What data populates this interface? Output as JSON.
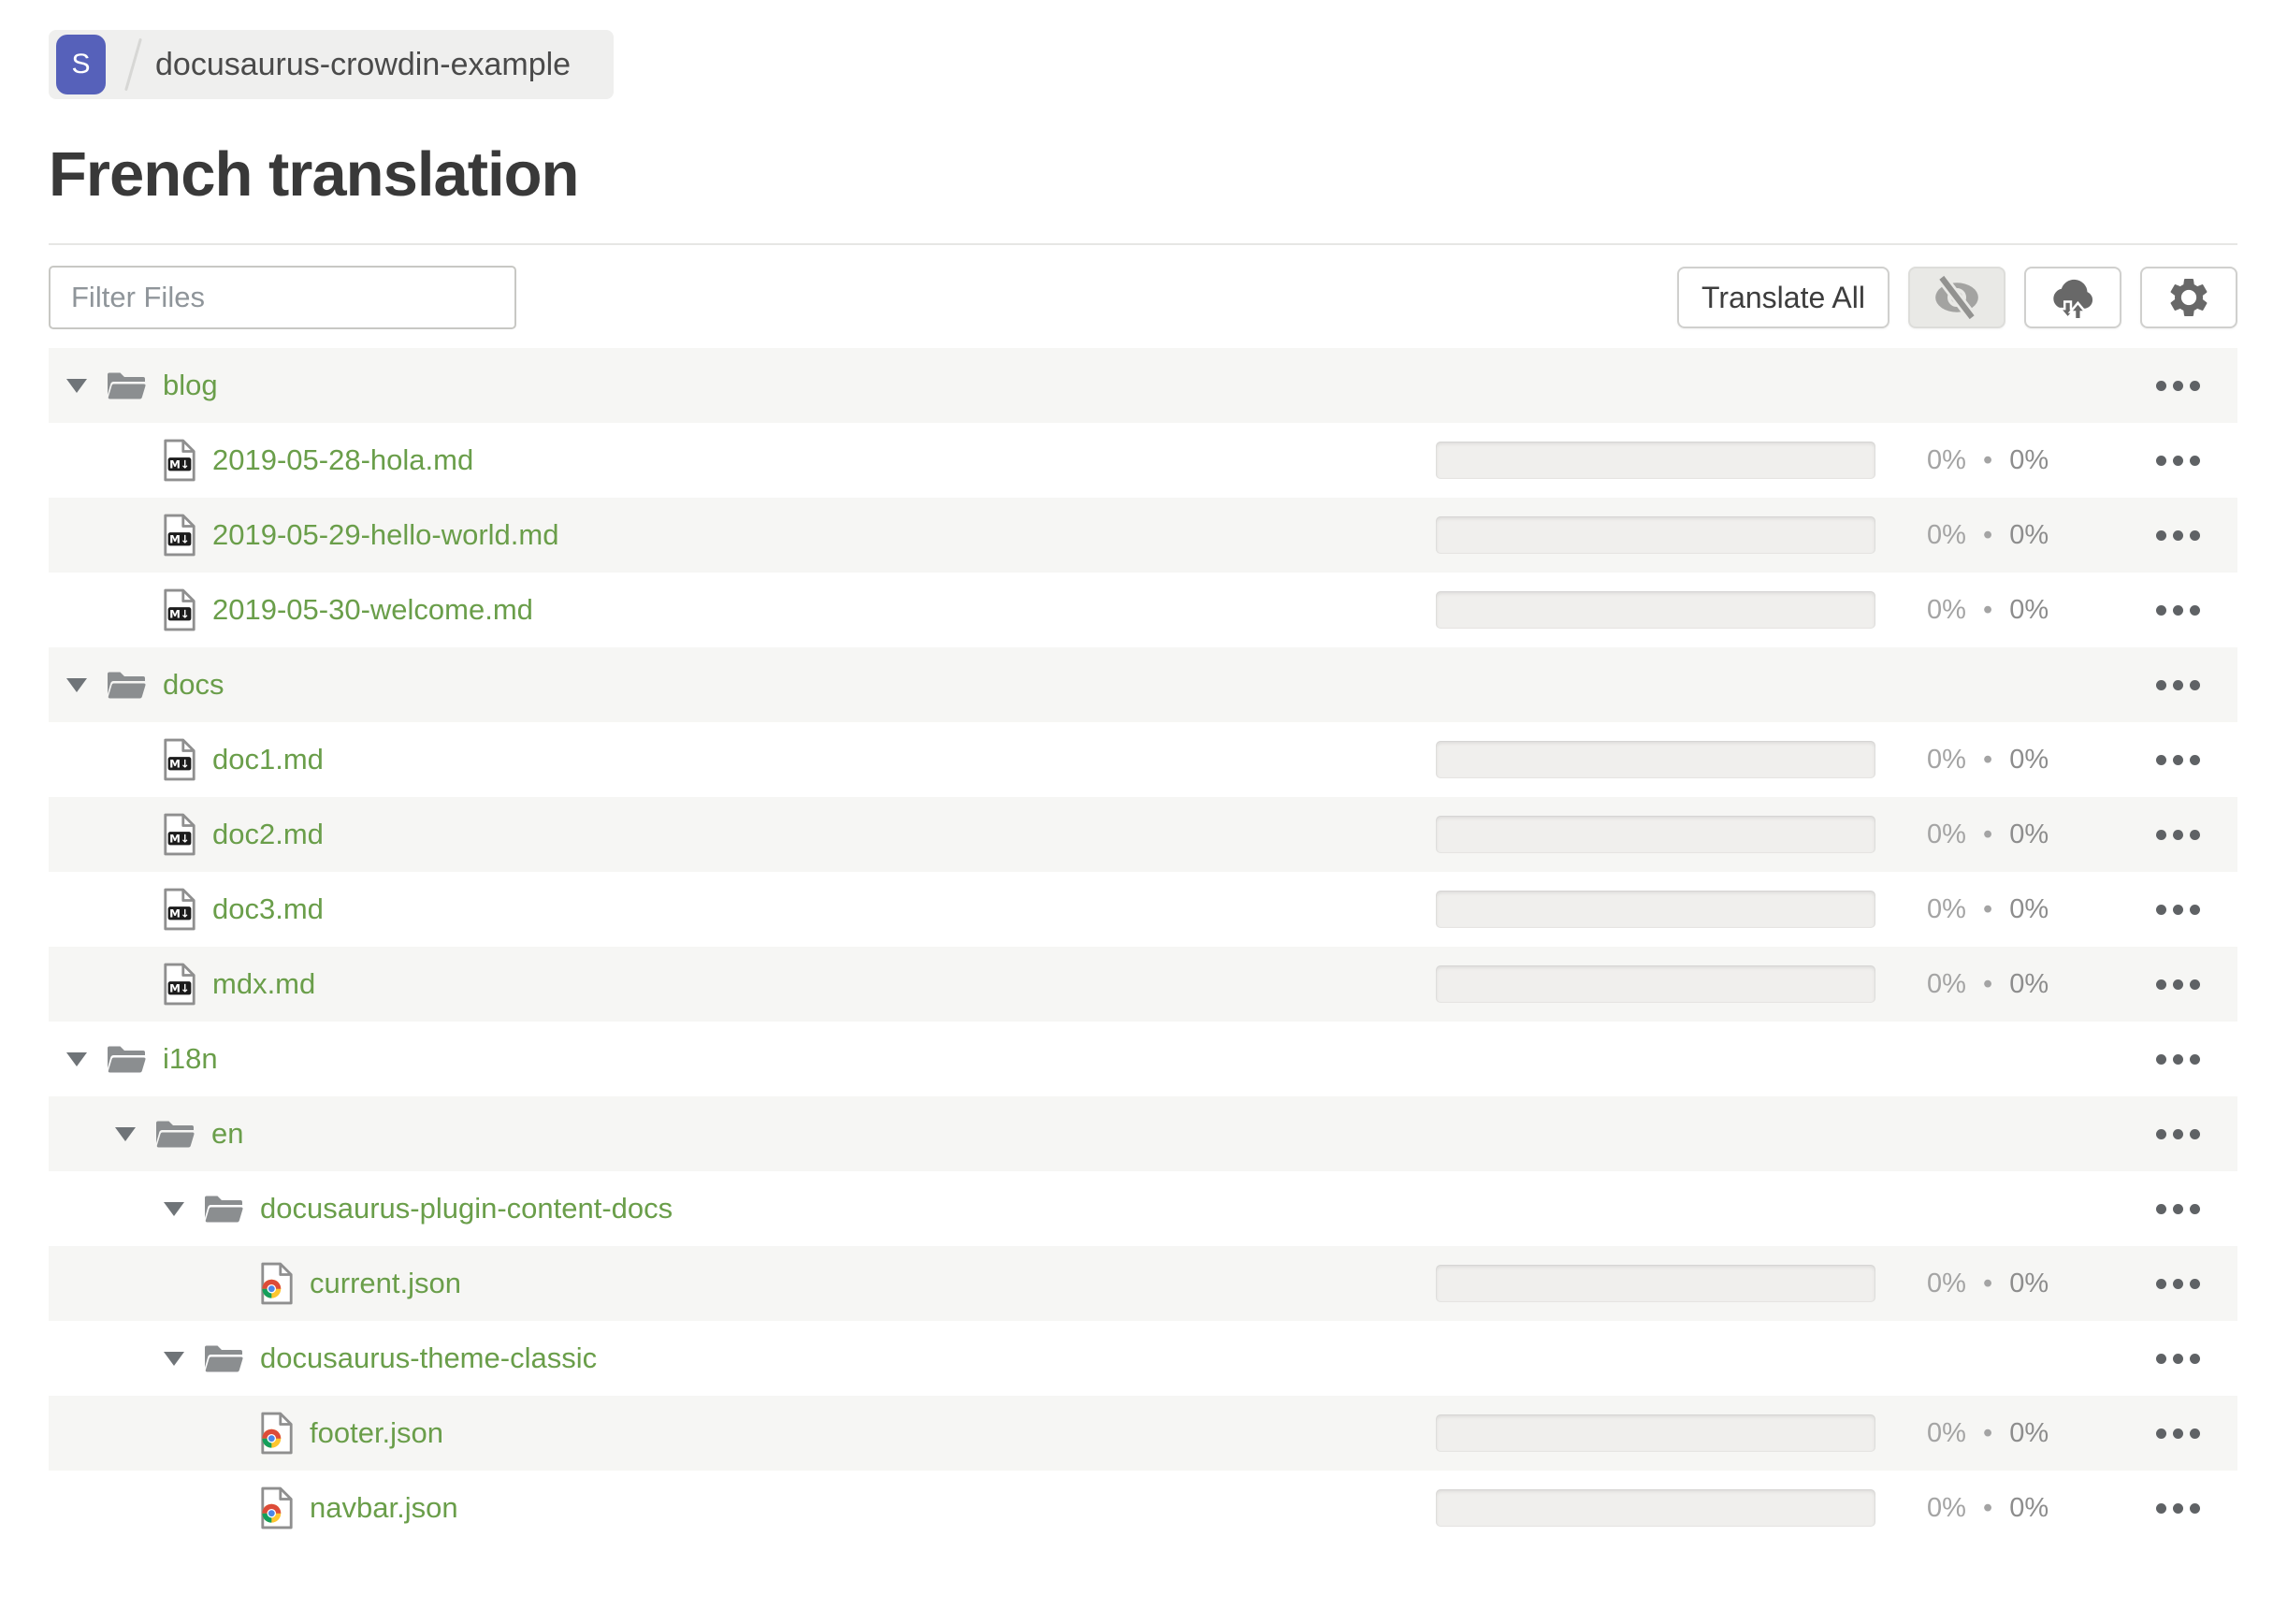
{
  "breadcrumb": {
    "avatar_letter": "S",
    "separator": "/",
    "project_name": "docusaurus-crowdin-example"
  },
  "page": {
    "title": "French translation"
  },
  "toolbar": {
    "filter_placeholder": "Filter Files",
    "translate_all_label": "Translate All",
    "buttons": [
      {
        "name": "hidden-files-toggle",
        "icon": "eye-off-icon",
        "toggled": true
      },
      {
        "name": "sync-button",
        "icon": "cloud-sync-icon",
        "toggled": false
      },
      {
        "name": "settings-button",
        "icon": "gear-icon",
        "toggled": false
      }
    ]
  },
  "colors": {
    "accent_green": "#6a9e4a",
    "avatar_bg": "#5661ba",
    "row_stripe": "#f6f6f4",
    "icon_gray": "#8b8e90",
    "dark_icon": "#686868"
  },
  "tree": {
    "progress_separator": "•",
    "rows": [
      {
        "type": "folder",
        "name": "blog",
        "level": 0
      },
      {
        "type": "file",
        "icon": "markdown-file-icon",
        "name": "2019-05-28-hola.md",
        "level": 1,
        "translated": "0%",
        "approved": "0%"
      },
      {
        "type": "file",
        "icon": "markdown-file-icon",
        "name": "2019-05-29-hello-world.md",
        "level": 1,
        "translated": "0%",
        "approved": "0%"
      },
      {
        "type": "file",
        "icon": "markdown-file-icon",
        "name": "2019-05-30-welcome.md",
        "level": 1,
        "translated": "0%",
        "approved": "0%"
      },
      {
        "type": "folder",
        "name": "docs",
        "level": 0
      },
      {
        "type": "file",
        "icon": "markdown-file-icon",
        "name": "doc1.md",
        "level": 1,
        "translated": "0%",
        "approved": "0%"
      },
      {
        "type": "file",
        "icon": "markdown-file-icon",
        "name": "doc2.md",
        "level": 1,
        "translated": "0%",
        "approved": "0%"
      },
      {
        "type": "file",
        "icon": "markdown-file-icon",
        "name": "doc3.md",
        "level": 1,
        "translated": "0%",
        "approved": "0%"
      },
      {
        "type": "file",
        "icon": "markdown-file-icon",
        "name": "mdx.md",
        "level": 1,
        "translated": "0%",
        "approved": "0%"
      },
      {
        "type": "folder",
        "name": "i18n",
        "level": 0
      },
      {
        "type": "folder",
        "name": "en",
        "level": 1
      },
      {
        "type": "folder",
        "name": "docusaurus-plugin-content-docs",
        "level": 2
      },
      {
        "type": "file",
        "icon": "json-file-icon",
        "name": "current.json",
        "level": 3,
        "translated": "0%",
        "approved": "0%"
      },
      {
        "type": "folder",
        "name": "docusaurus-theme-classic",
        "level": 2
      },
      {
        "type": "file",
        "icon": "json-file-icon",
        "name": "footer.json",
        "level": 3,
        "translated": "0%",
        "approved": "0%"
      },
      {
        "type": "file",
        "icon": "json-file-icon",
        "name": "navbar.json",
        "level": 3,
        "translated": "0%",
        "approved": "0%"
      }
    ]
  }
}
